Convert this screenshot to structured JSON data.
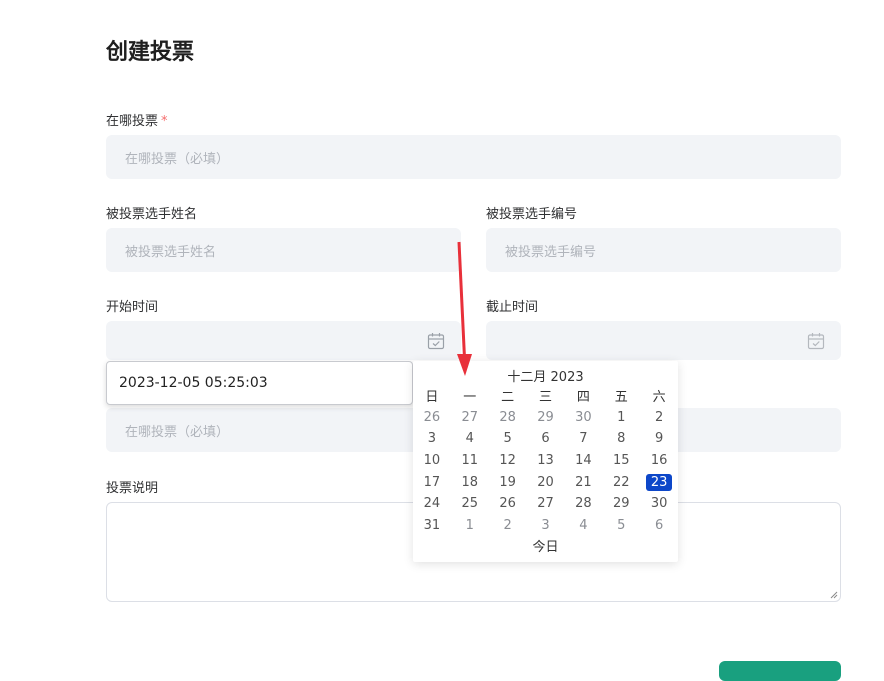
{
  "page": {
    "title": "创建投票"
  },
  "form": {
    "where": {
      "label": "在哪投票",
      "required_mark": "*",
      "placeholder": "在哪投票（必填）"
    },
    "candidate_name": {
      "label": "被投票选手姓名",
      "placeholder": "被投票选手姓名"
    },
    "candidate_number": {
      "label": "被投票选手编号",
      "placeholder": "被投票选手编号"
    },
    "start_time": {
      "label": "开始时间",
      "value": "2023-12-05 05:25:03"
    },
    "end_time": {
      "label": "截止时间"
    },
    "hidden_field": {
      "placeholder": "在哪投票（必填）"
    },
    "description": {
      "label": "投票说明"
    }
  },
  "calendar": {
    "title": "十二月 2023",
    "weekdays": [
      "日",
      "一",
      "二",
      "三",
      "四",
      "五",
      "六"
    ],
    "weeks": [
      [
        "26",
        "27",
        "28",
        "29",
        "30",
        "1",
        "2"
      ],
      [
        "3",
        "4",
        "5",
        "6",
        "7",
        "8",
        "9"
      ],
      [
        "10",
        "11",
        "12",
        "13",
        "14",
        "15",
        "16"
      ],
      [
        "17",
        "18",
        "19",
        "20",
        "21",
        "22",
        "23"
      ],
      [
        "24",
        "25",
        "26",
        "27",
        "28",
        "29",
        "30"
      ],
      [
        "31",
        "1",
        "2",
        "3",
        "4",
        "5",
        "6"
      ]
    ],
    "selected_day": "23",
    "today_label": "今日"
  },
  "colors": {
    "accent": "#0d47c9",
    "submit": "#19a07f",
    "arrow": "#e8303a",
    "input_bg": "#f2f4f7"
  },
  "icons": {
    "calendar": "calendar-icon",
    "resize": "resize-grip-icon",
    "annotation": "red-arrow-annotation"
  }
}
